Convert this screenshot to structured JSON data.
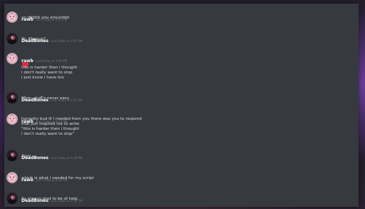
{
  "messages": [
    {
      "author": "rawb",
      "timestamp": "Last Friday at 4:03 PM",
      "avatar": "pig-avatar",
      "lines": [
        "yo dbbbb you arounddd"
      ]
    },
    {
      "author": "DeadBones",
      "timestamp": "Last Friday at 4:05 PM",
      "avatar": "dark-avatar",
      "lines": [
        "Ye, Wassup?"
      ]
    },
    {
      "author": "rawb",
      "timestamp": "Last Friday at 4:05 PM",
      "avatar": "pig-avatar",
      "emoji": "heart-emoji",
      "lines": [
        "this is harder then i thought",
        "i don't really want to stop",
        "i just know i have too"
      ]
    },
    {
      "author": "DeadBones",
      "timestamp": "Last Friday at 4:15 PM",
      "avatar": "dark-avatar",
      "lines": [
        "Mhm, stuff's never easy"
      ]
    },
    {
      "author": "rawb",
      "timestamp": "Last Friday at 4:30 PM",
      "avatar": "pig-avatar",
      "lines": [
        "honestly bud ill i needed from you there was you to respond",
        "that just inspired me to write",
        "\"this is harder then i thought",
        "i don't really want to stop\""
      ]
    },
    {
      "author": "DeadBones",
      "timestamp": "Last Friday at 4:30 PM",
      "avatar": "dark-avatar",
      "lines": [
        "Ayyy"
      ]
    },
    {
      "author": "rawb",
      "timestamp": "Last Friday at 4:30 PM",
      "avatar": "pig-avatar",
      "lines": [
        "which is what i needed for my script"
      ]
    },
    {
      "author": "DeadBones",
      "timestamp": "Last Friday at 4:30 PM",
      "avatar": "dark-avatar",
      "lines": [
        "As always glad to be of help"
      ]
    }
  ],
  "colors": {
    "panel": "#36393f",
    "text": "#dcddde",
    "author": "#ffffff",
    "timestamp": "#72767d",
    "heart": "#dd2e44"
  }
}
